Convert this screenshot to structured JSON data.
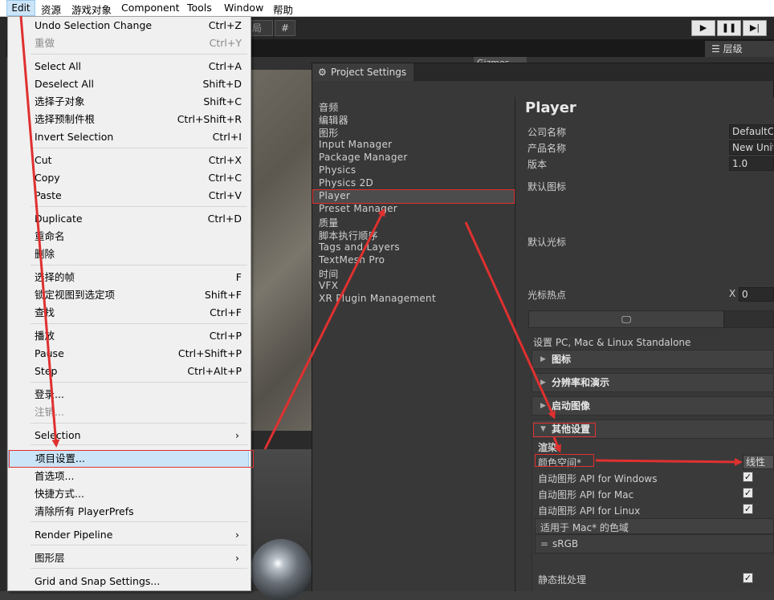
{
  "menubar": {
    "items": [
      "Edit",
      "资源",
      "游戏对象",
      "Component",
      "Tools",
      "Window",
      "帮助"
    ]
  },
  "toolbar": {
    "btn_a": "局",
    "btn_b": "",
    "gizmos": "Gizmos",
    "hierarchy_tab": "层级"
  },
  "edit_menu": {
    "items": [
      {
        "label": "Undo Selection Change",
        "shortcut": "Ctrl+Z"
      },
      {
        "label": "重做",
        "shortcut": "Ctrl+Y"
      },
      {
        "label": "Select All",
        "shortcut": "Ctrl+A"
      },
      {
        "label": "Deselect All",
        "shortcut": "Shift+D"
      },
      {
        "label": "选择子对象",
        "shortcut": "Shift+C"
      },
      {
        "label": "选择预制件根",
        "shortcut": "Ctrl+Shift+R"
      },
      {
        "label": "Invert Selection",
        "shortcut": "Ctrl+I"
      },
      {
        "label": "Cut",
        "shortcut": "Ctrl+X"
      },
      {
        "label": "Copy",
        "shortcut": "Ctrl+C"
      },
      {
        "label": "Paste",
        "shortcut": "Ctrl+V"
      },
      {
        "label": "Duplicate",
        "shortcut": "Ctrl+D"
      },
      {
        "label": "重命名",
        "shortcut": ""
      },
      {
        "label": "删除",
        "shortcut": ""
      },
      {
        "label": "选择的帧",
        "shortcut": "F"
      },
      {
        "label": "锁定视图到选定项",
        "shortcut": "Shift+F"
      },
      {
        "label": "查找",
        "shortcut": "Ctrl+F"
      },
      {
        "label": "播放",
        "shortcut": "Ctrl+P"
      },
      {
        "label": "Pause",
        "shortcut": "Ctrl+Shift+P"
      },
      {
        "label": "Step",
        "shortcut": "Ctrl+Alt+P"
      },
      {
        "label": "登录...",
        "shortcut": ""
      },
      {
        "label": "注销...",
        "shortcut": ""
      },
      {
        "label": "Selection",
        "shortcut": ""
      },
      {
        "label": "项目设置...",
        "shortcut": ""
      },
      {
        "label": "首选项...",
        "shortcut": ""
      },
      {
        "label": "快捷方式...",
        "shortcut": ""
      },
      {
        "label": "清除所有 PlayerPrefs",
        "shortcut": ""
      },
      {
        "label": "Render Pipeline",
        "shortcut": ""
      },
      {
        "label": "图形层",
        "shortcut": ""
      },
      {
        "label": "Grid and Snap Settings...",
        "shortcut": ""
      }
    ]
  },
  "project_settings": {
    "title": "Project Settings",
    "categories": [
      "音频",
      "编辑器",
      "图形",
      "Input Manager",
      "Package Manager",
      "Physics",
      "Physics 2D",
      "Player",
      "Preset Manager",
      "质量",
      "脚本执行顺序",
      "Tags and Layers",
      "TextMesh Pro",
      "时间",
      "VFX",
      "XR Plugin Management"
    ],
    "selected_category": "Player",
    "player": {
      "heading": "Player",
      "company_label": "公司名称",
      "company_value": "DefaultCompany",
      "product_label": "产品名称",
      "product_value": "New Unity Project",
      "version_label": "版本",
      "version_value": "1.0",
      "default_icon_label": "默认图标",
      "default_cursor_label": "默认光标",
      "cursor_hotspot_label": "光标热点",
      "hotspot_x_label": "X",
      "hotspot_x_value": "0",
      "platform_title": "设置 PC, Mac & Linux Standalone",
      "sections": [
        "图标",
        "分辨率和演示",
        "启动图像",
        "其他设置"
      ],
      "rendering_label": "渲染",
      "color_space_label": "颜色空间*",
      "color_space_value": "线性",
      "auto_api_windows": "自动图形 API   for Windows",
      "auto_api_mac": "自动图形 API   for Mac",
      "auto_api_linux": "自动图形 API   for Linux",
      "mac_color_gamut": "适用于 Mac* 的色域",
      "srgb": "sRGB",
      "static_batching": "静态批处理"
    }
  },
  "colors": {
    "annotation_red": "#e03030",
    "menu_highlight": "#cce4f7"
  }
}
